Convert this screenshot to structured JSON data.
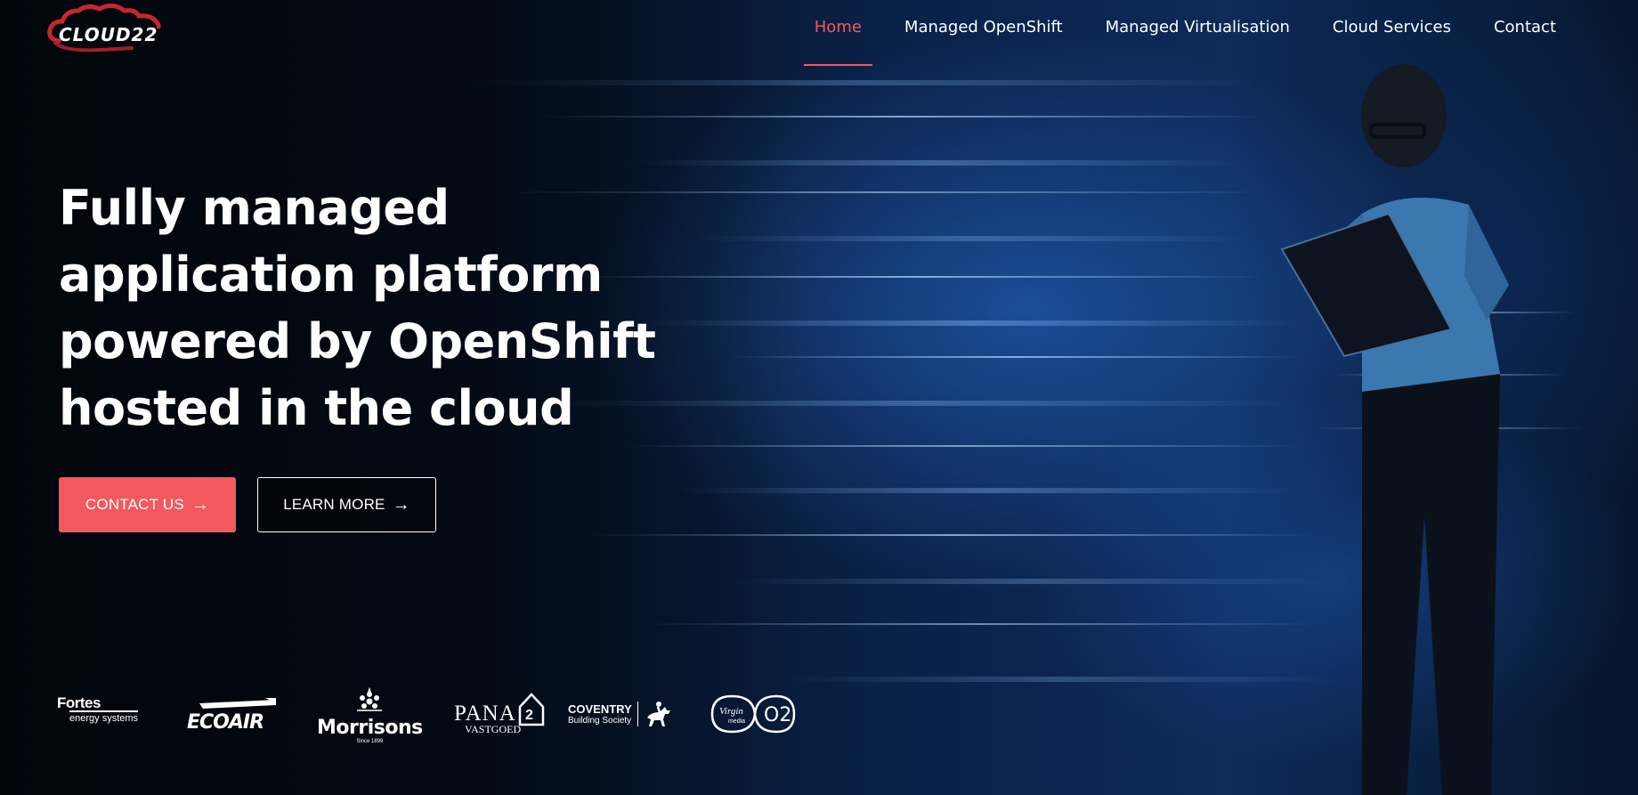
{
  "brand": {
    "logo_text": "CLOUD22"
  },
  "nav": {
    "items": [
      {
        "label": "Home",
        "active": true
      },
      {
        "label": "Managed OpenShift",
        "active": false
      },
      {
        "label": "Managed Virtualisation",
        "active": false
      },
      {
        "label": "Cloud Services",
        "active": false
      },
      {
        "label": "Contact",
        "active": false
      }
    ]
  },
  "hero": {
    "headline_lines": [
      "Fully managed",
      "application platform",
      "powered by OpenShift",
      "hosted in the cloud"
    ],
    "contact_button": "CONTACT US",
    "learn_button": "LEARN MORE",
    "arrow_icon": "arrow-right-icon"
  },
  "clients": {
    "fortes": {
      "name": "Fortes",
      "sub": "energy systems"
    },
    "ecoair": {
      "name": "ECOAIR"
    },
    "morrisons": {
      "name": "Morrisons",
      "since": "Since 1899"
    },
    "pana": {
      "name": "PANA",
      "sub": "VASTGOED"
    },
    "coventry": {
      "name": "COVENTRY",
      "sub": "Building Society"
    },
    "virgin": {
      "name": "Virgin media",
      "o2": "O2"
    }
  },
  "colors": {
    "accent": "#f4585f",
    "background": "#050a14"
  }
}
